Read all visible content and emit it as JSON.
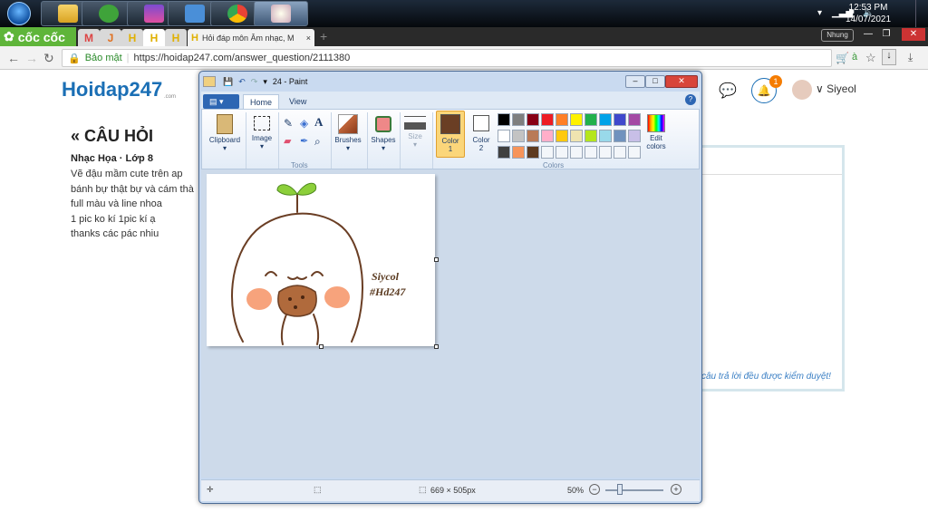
{
  "taskbar": {
    "clock_time": "12:53 PM",
    "clock_date": "14/07/2021"
  },
  "browser": {
    "brand": "cốc cốc",
    "tabs": [
      "M",
      "J",
      "H",
      "H",
      "H"
    ],
    "active_tab_title": "Hỏi đáp môn Âm nhạc, M",
    "profile_label": "Nhung",
    "secure_label": "Bảo mật",
    "url": "https://hoidap247.com/answer_question/2111380"
  },
  "page": {
    "logo": "Hoidap247",
    "logo_suffix": ".com",
    "notification_count": "1",
    "username": "Siyeol",
    "question_title": "« CÂU HỎI",
    "question_meta": "Nhạc Họa · Lớp 8",
    "question_lines": [
      "Vẽ đậu mầm cute trên ap",
      "bánh bự thật bự và cám thà",
      "full màu và line nhoa",
      "1 pic ko kí 1pic kí ạ",
      "thanks các pác nhiu"
    ],
    "panel_text": "câu trả lời đều được kiểm duyệt!"
  },
  "paint": {
    "title": "24 - Paint",
    "tabs": [
      "Home",
      "View"
    ],
    "groups": {
      "clipboard": "Clipboard",
      "image": "Image",
      "tools": "Tools",
      "brushes": "Brushes",
      "shapes": "Shapes",
      "size": "Size",
      "color1": "Color 1",
      "color2": "Color 2",
      "colors": "Colors",
      "edit_colors": "Edit colors"
    },
    "palette": [
      "#000000",
      "#7f7f7f",
      "#880015",
      "#ed1c24",
      "#ff7f27",
      "#fff200",
      "#22b14c",
      "#00a2e8",
      "#3f48cc",
      "#a349a4",
      "#ffffff",
      "#c3c3c3",
      "#b97a57",
      "#ffaec9",
      "#ffc90e",
      "#efe4b0",
      "#b5e61d",
      "#99d9ea",
      "#7092be",
      "#c8bfe7",
      "#404040",
      "#f7945a",
      "#5e3a1f"
    ],
    "color1": "#6a3e24",
    "color2": "#ffffff",
    "artwork_text": [
      "Siycol",
      "#Hd247"
    ],
    "status_size": "669 × 505px",
    "zoom": "50%"
  }
}
